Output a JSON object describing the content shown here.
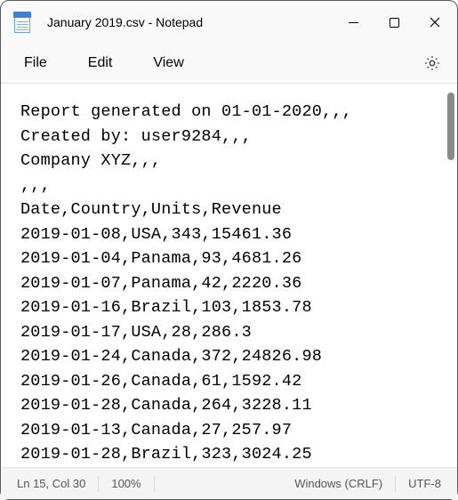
{
  "window": {
    "title": "January 2019.csv - Notepad"
  },
  "menu": {
    "file": "File",
    "edit": "Edit",
    "view": "View"
  },
  "content": {
    "lines": [
      "Report generated on 01-01-2020,,,",
      "Created by: user9284,,,",
      "Company XYZ,,,",
      ",,,",
      "Date,Country,Units,Revenue",
      "2019-01-08,USA,343,15461.36",
      "2019-01-04,Panama,93,4681.26",
      "2019-01-07,Panama,42,2220.36",
      "2019-01-16,Brazil,103,1853.78",
      "2019-01-17,USA,28,286.3",
      "2019-01-24,Canada,372,24826.98",
      "2019-01-26,Canada,61,1592.42",
      "2019-01-28,Canada,264,3228.11",
      "2019-01-13,Canada,27,257.97",
      "2019-01-28,Brazil,323,3024.25"
    ]
  },
  "status": {
    "position": "Ln 15, Col 30",
    "zoom": "100%",
    "line_ending": "Windows (CRLF)",
    "encoding": "UTF-8"
  }
}
